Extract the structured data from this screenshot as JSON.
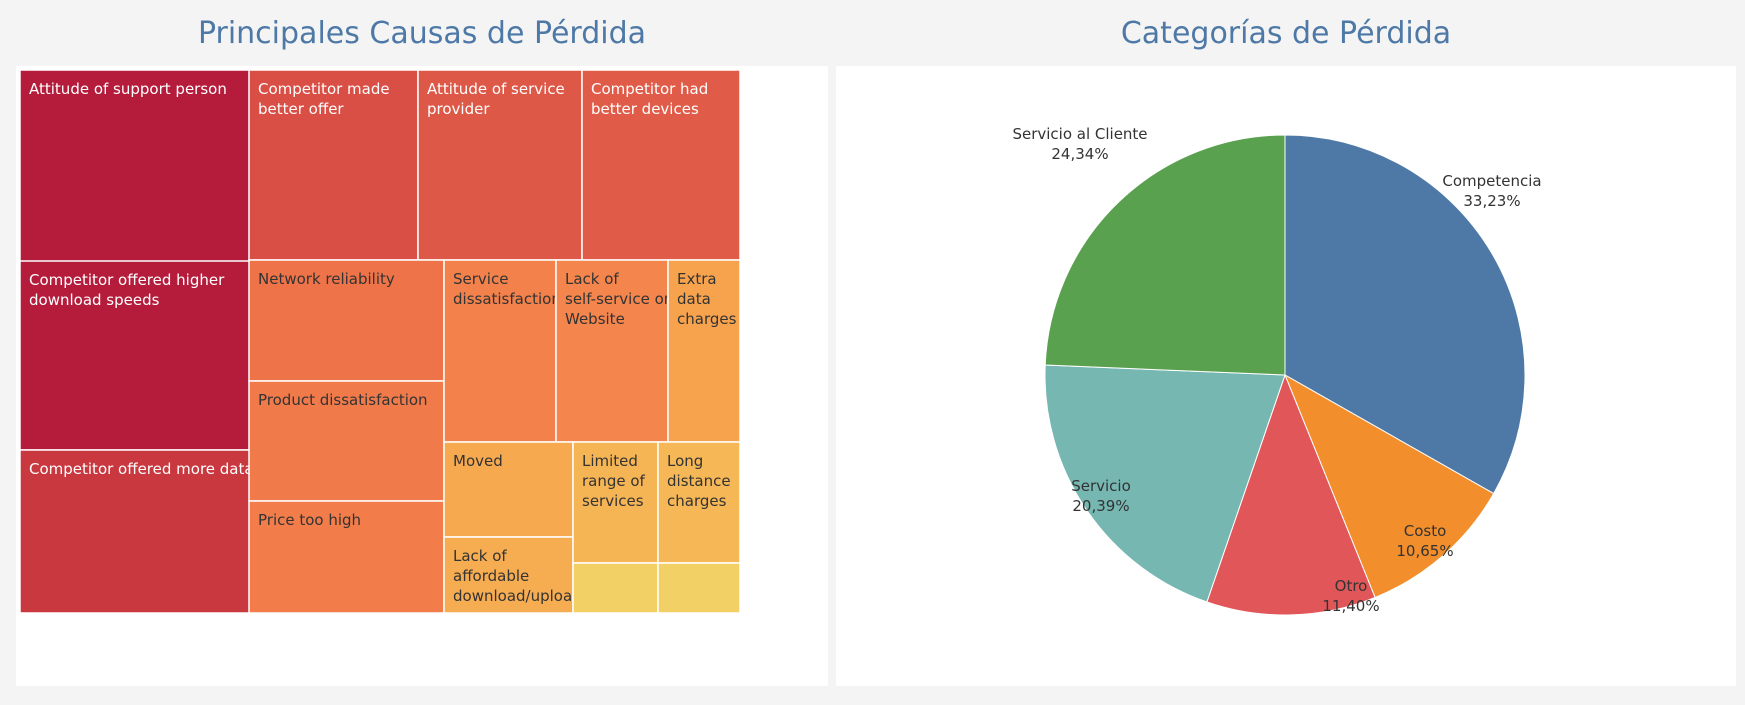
{
  "dashboard": {
    "treemap_title": "Principales Causas de Pérdida",
    "pie_title": "Categorías de Pérdida"
  },
  "chart_data": [
    {
      "type": "treemap",
      "title": "Principales Causas de Pérdida",
      "cells": [
        {
          "label": "Attitude of support person",
          "color": "#b51c3c",
          "text_color": "#ffffff"
        },
        {
          "label": "Competitor offered higher download speeds",
          "color": "#b51c3c",
          "text_color": "#ffffff"
        },
        {
          "label": "Competitor offered more data",
          "color": "#c9373f",
          "text_color": "#ffffff"
        },
        {
          "label": "Competitor made better offer",
          "color": "#d94e45",
          "text_color": "#ffffff"
        },
        {
          "label": "Attitude of service provider",
          "color": "#de5848",
          "text_color": "#ffffff"
        },
        {
          "label": "Competitor had better devices",
          "color": "#e05c49",
          "text_color": "#ffffff"
        },
        {
          "label": "Network reliability",
          "color": "#ef7349",
          "text_color": "#333333"
        },
        {
          "label": "Product dissatisfaction",
          "color": "#f07a4a",
          "text_color": "#333333"
        },
        {
          "label": "Price too high",
          "color": "#f27d4a",
          "text_color": "#333333"
        },
        {
          "label": "Service dissatisfaction",
          "color": "#f3814b",
          "text_color": "#333333"
        },
        {
          "label": "Lack of self-service on Website",
          "color": "#f4854c",
          "text_color": "#333333"
        },
        {
          "label": "Extra data charges",
          "color": "#f7a34e",
          "text_color": "#333333"
        },
        {
          "label": "Moved",
          "color": "#f6a94f",
          "text_color": "#333333"
        },
        {
          "label": "Lack of affordable download/upload",
          "color": "#f6ac51",
          "text_color": "#333333"
        },
        {
          "label": "Limited range of services",
          "color": "#f6b555",
          "text_color": "#333333"
        },
        {
          "label": "Long distance charges",
          "color": "#f6b757",
          "text_color": "#333333"
        },
        {
          "label": "",
          "color": "#f3d066",
          "text_color": "#333333"
        },
        {
          "label": "",
          "color": "#f3d066",
          "text_color": "#333333"
        }
      ]
    },
    {
      "type": "pie",
      "title": "Categorías de Pérdida",
      "slices": [
        {
          "name": "Competencia",
          "value": 33.23,
          "label": "33,23%",
          "color": "#4e79a7"
        },
        {
          "name": "Costo",
          "value": 10.65,
          "label": "10,65%",
          "color": "#f28e2b"
        },
        {
          "name": "Otro",
          "value": 11.4,
          "label": "11,40%",
          "color": "#e15759"
        },
        {
          "name": "Servicio",
          "value": 20.39,
          "label": "20,39%",
          "color": "#76b7b2"
        },
        {
          "name": "Servicio al Cliente",
          "value": 24.34,
          "label": "24,34%",
          "color": "#59a14f"
        }
      ]
    }
  ]
}
